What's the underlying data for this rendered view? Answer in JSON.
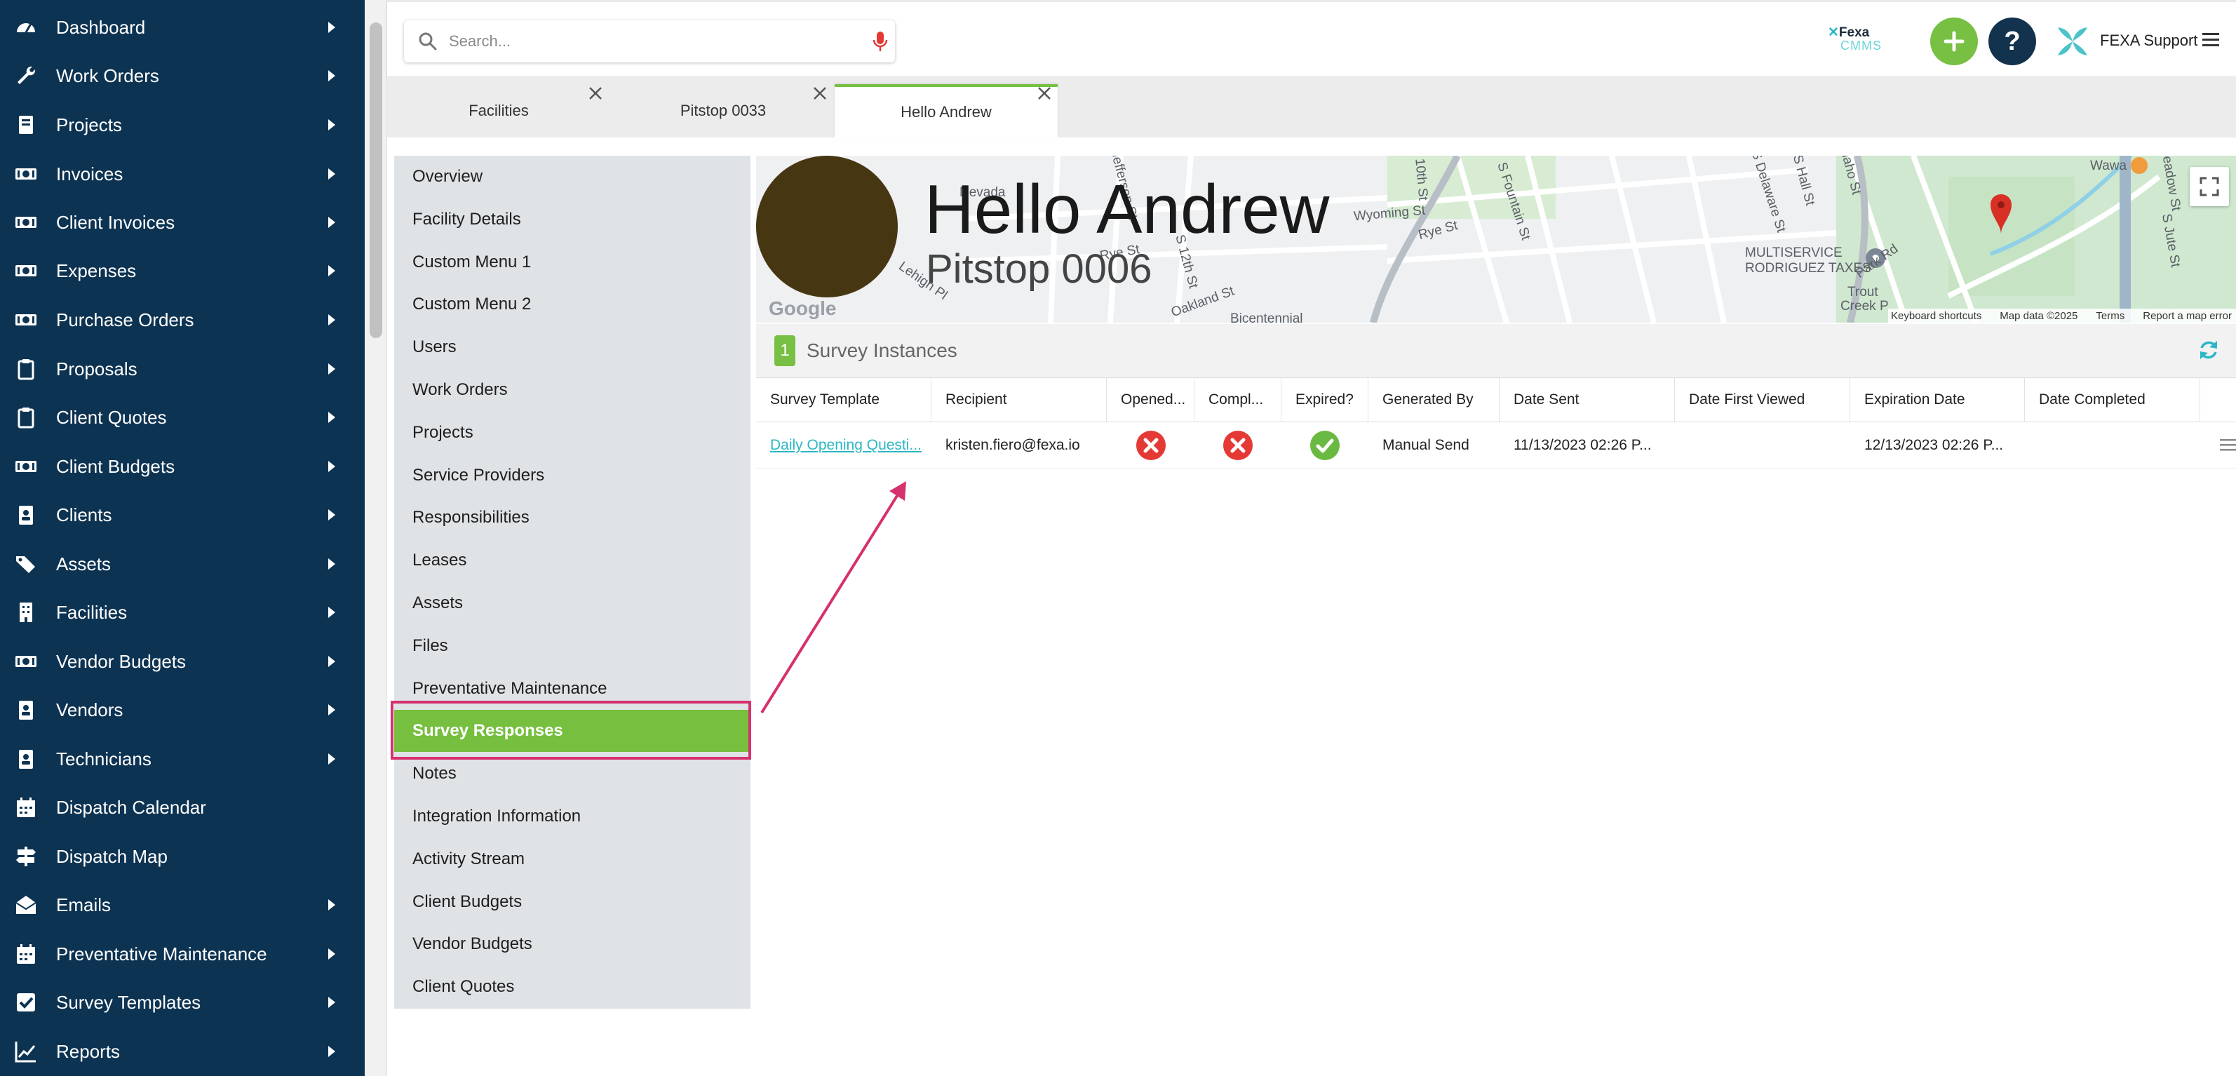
{
  "sidebar": {
    "items": [
      {
        "label": "Dashboard",
        "icon": "speedometer-icon",
        "caret": true
      },
      {
        "label": "Work Orders",
        "icon": "wrench-icon",
        "caret": true
      },
      {
        "label": "Projects",
        "icon": "book-icon",
        "caret": true
      },
      {
        "label": "Invoices",
        "icon": "money-icon",
        "caret": true
      },
      {
        "label": "Client Invoices",
        "icon": "money-icon",
        "caret": true
      },
      {
        "label": "Expenses",
        "icon": "money-icon",
        "caret": true
      },
      {
        "label": "Purchase Orders",
        "icon": "money-icon",
        "caret": true
      },
      {
        "label": "Proposals",
        "icon": "clipboard-icon",
        "caret": true
      },
      {
        "label": "Client Quotes",
        "icon": "clipboard-icon",
        "caret": true
      },
      {
        "label": "Client Budgets",
        "icon": "money-icon",
        "caret": true
      },
      {
        "label": "Clients",
        "icon": "contact-card-icon",
        "caret": true
      },
      {
        "label": "Assets",
        "icon": "tags-icon",
        "caret": true
      },
      {
        "label": "Facilities",
        "icon": "building-icon",
        "caret": true
      },
      {
        "label": "Vendor Budgets",
        "icon": "money-icon",
        "caret": true
      },
      {
        "label": "Vendors",
        "icon": "contact-card-icon",
        "caret": true
      },
      {
        "label": "Technicians",
        "icon": "contact-card-icon",
        "caret": true
      },
      {
        "label": "Dispatch Calendar",
        "icon": "calendar-icon",
        "caret": false
      },
      {
        "label": "Dispatch Map",
        "icon": "signpost-icon",
        "caret": false
      },
      {
        "label": "Emails",
        "icon": "envelope-open-icon",
        "caret": true
      },
      {
        "label": "Preventative Maintenance",
        "icon": "calendar-icon",
        "caret": true
      },
      {
        "label": "Survey Templates",
        "icon": "checkbox-icon",
        "caret": true
      },
      {
        "label": "Reports",
        "icon": "line-chart-icon",
        "caret": true
      }
    ]
  },
  "topbar": {
    "search_placeholder": "Search...",
    "logo_top": "Fexa",
    "logo_bottom": "CMMS",
    "add_label": "+",
    "help_label": "?",
    "org_name": "FEXA Support"
  },
  "tabs": [
    {
      "label": "Facilities",
      "active": false
    },
    {
      "label": "Pitstop 0033",
      "active": false
    },
    {
      "label": "Hello Andrew",
      "active": true
    }
  ],
  "facility_menu": {
    "items": [
      "Overview",
      "Facility Details",
      "Custom Menu 1",
      "Custom Menu 2",
      "Users",
      "Work Orders",
      "Projects",
      "Service Providers",
      "Responsibilities",
      "Leases",
      "Assets",
      "Files",
      "Preventative Maintenance",
      "Survey Responses",
      "Notes",
      "Integration Information",
      "Activity Stream",
      "Client Budgets",
      "Vendor Budgets",
      "Client Quotes"
    ],
    "active": "Survey Responses"
  },
  "facility": {
    "title": "Hello Andrew",
    "subtitle": "Pitstop 0006",
    "avatar_color": "#473612"
  },
  "map": {
    "labels": [
      {
        "text": "Nevada"
      },
      {
        "text": "S Jefferson St"
      },
      {
        "text": "S 10th St"
      },
      {
        "text": "Rye St"
      },
      {
        "text": "Wyoming St"
      },
      {
        "text": "S Fountain St"
      },
      {
        "text": "S Delaware St"
      },
      {
        "text": "S Hall St"
      },
      {
        "text": "Idaho St"
      },
      {
        "text": "Park Rd"
      },
      {
        "text": "Wawa"
      },
      {
        "text": "S Meadow St"
      },
      {
        "text": "S Jute St"
      },
      {
        "text": "MULTISERVICE"
      },
      {
        "text": "RODRIGUEZ TAXES"
      },
      {
        "text": "Trout"
      },
      {
        "text": "Creek P"
      },
      {
        "text": "Bicentennial"
      },
      {
        "text": "Lehigh Pl"
      },
      {
        "text": "Rye St"
      },
      {
        "text": "S 12th St"
      },
      {
        "text": "Oakland St"
      }
    ],
    "google": "Google",
    "footer": [
      "Keyboard shortcuts",
      "Map data ©2025",
      "Terms",
      "Report a map error"
    ]
  },
  "survey_panel": {
    "count": "1",
    "title": "Survey Instances",
    "columns": [
      "Survey Template",
      "Recipient",
      "Opened...",
      "Compl...",
      "Expired?",
      "Generated By",
      "Date Sent",
      "Date First Viewed",
      "Expiration Date",
      "Date Completed"
    ],
    "rows": [
      {
        "template": "Daily Opening Questi...",
        "recipient": "kristen.fiero@fexa.io",
        "opened": false,
        "completed": false,
        "expired": true,
        "generated_by": "Manual Send",
        "date_sent": "11/13/2023 02:26 P...",
        "date_first_viewed": "",
        "expiration_date": "12/13/2023 02:26 P...",
        "date_completed": ""
      }
    ]
  },
  "colors": {
    "nav_bg": "#0d3352",
    "accent_green": "#77c043",
    "highlight_pink": "#d6316f",
    "status_red": "#e53935",
    "status_green": "#6ab942",
    "link": "#2cb7c4"
  }
}
